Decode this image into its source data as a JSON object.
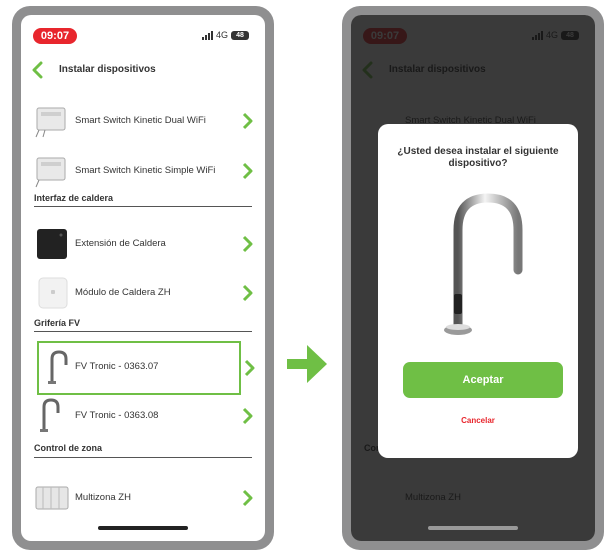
{
  "status": {
    "time": "09:07",
    "network": "4G",
    "battery": "48"
  },
  "header": {
    "title": "Instalar dispositivos"
  },
  "items": [
    {
      "label": "Smart Switch Kinetic Dual WiFi",
      "icon": "switch-device-icon"
    },
    {
      "label": "Smart Switch Kinetic Simple WiFi",
      "icon": "switch-device-icon"
    },
    {
      "label": "Extensión de Caldera",
      "icon": "boiler-extension-icon"
    },
    {
      "label": "Módulo de Caldera ZH",
      "icon": "boiler-module-icon"
    },
    {
      "label": "FV Tronic - 0363.07",
      "icon": "faucet-icon"
    },
    {
      "label": "FV Tronic - 0363.08",
      "icon": "faucet-icon"
    },
    {
      "label": "Multizona ZH",
      "icon": "multizone-icon"
    }
  ],
  "sections": [
    {
      "title": "Interfaz de caldera"
    },
    {
      "title": "Grifería FV"
    },
    {
      "title": "Control de zona"
    }
  ],
  "modal": {
    "title": "¿Usted desea instalar el siguiente dispositivo?",
    "accept": "Aceptar",
    "cancel": "Cancelar"
  },
  "colors": {
    "accent_green": "#6fbf45",
    "accent_red": "#e8262d",
    "frame_gray": "#8f8f90"
  }
}
